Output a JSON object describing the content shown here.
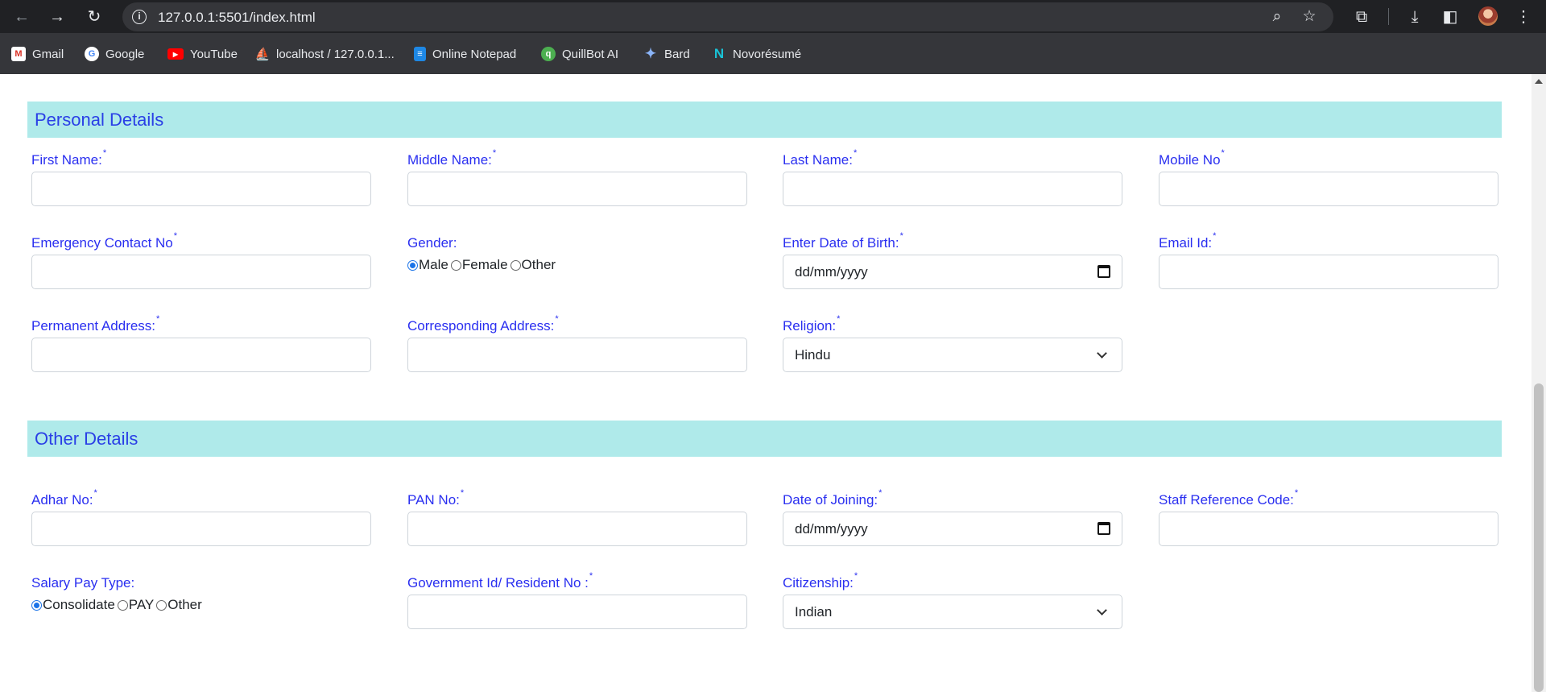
{
  "browser": {
    "url": "127.0.0.1:5501/index.html",
    "bookmarks": [
      "Gmail",
      "Google",
      "YouTube",
      "localhost / 127.0.0.1...",
      "Online Notepad",
      "QuillBot AI",
      "Bard",
      "Novorésumé"
    ]
  },
  "personal": {
    "title": "Personal Details",
    "first_name": "First Name:",
    "middle_name": "Middle Name:",
    "last_name": "Last Name:",
    "mobile": "Mobile No",
    "emergency": "Emergency Contact No",
    "gender": "Gender:",
    "gender_options": [
      "Male",
      "Female",
      "Other"
    ],
    "gender_selected": "Male",
    "dob": "Enter Date of Birth:",
    "dob_value": "dd/mm/yyyy",
    "email": "Email Id:",
    "permanent_address": "Permanent Address:",
    "corresponding_address": "Corresponding Address:",
    "religion": "Religion:",
    "religion_value": "Hindu"
  },
  "other": {
    "title": "Other Details",
    "adhar": "Adhar No:",
    "pan": "PAN No:",
    "doj": "Date of Joining:",
    "doj_value": "dd/mm/yyyy",
    "staff_ref": "Staff Reference Code:",
    "salary_type": "Salary Pay Type:",
    "salary_options": [
      "Consolidate",
      "PAY",
      "Other"
    ],
    "salary_selected": "Consolidate",
    "govt_id": "Government Id/ Resident No :",
    "citizenship": "Citizenship:",
    "citizenship_value": "Indian"
  },
  "required_mark": "*",
  "colors": {
    "label": "#2a2ff0",
    "header_bg": "#afeaea",
    "header_text": "#2a3fe6"
  }
}
